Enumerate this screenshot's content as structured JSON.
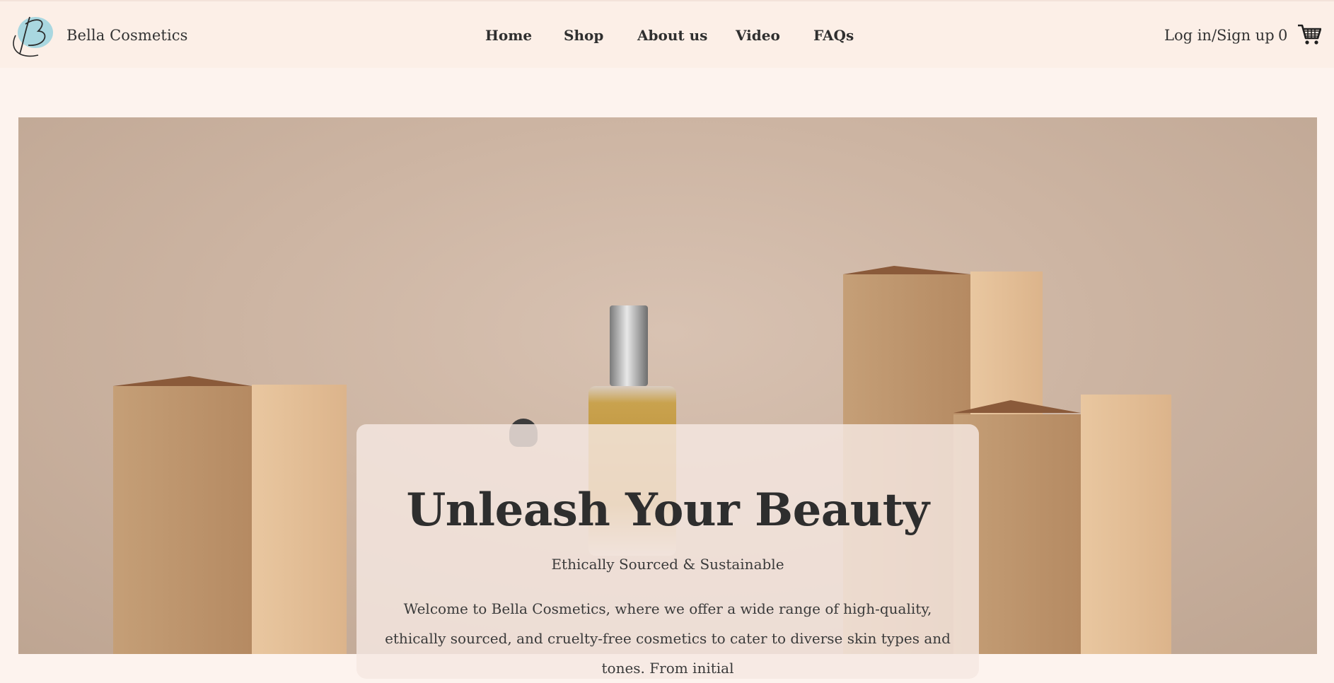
{
  "brand": {
    "name": "Bella Cosmetics",
    "logo_letter": "B"
  },
  "nav": {
    "items": [
      {
        "label": "Home"
      },
      {
        "label": "Shop"
      },
      {
        "label": "About us"
      },
      {
        "label": "Video"
      },
      {
        "label": "FAQs"
      }
    ]
  },
  "account": {
    "login_label": "Log in/Sign up"
  },
  "cart": {
    "count": "0",
    "icon": "cart-icon"
  },
  "hero": {
    "title": "Unleash Your Beauty",
    "subtitle": "Ethically Sourced & Sustainable",
    "body": "Welcome to Bella Cosmetics, where we offer a wide range of high-quality, ethically sourced, and cruelty-free cosmetics to cater to diverse skin types and tones. From initial"
  },
  "colors": {
    "page_bg": "#fdf3ee",
    "header_bg": "#fcefe7",
    "text": "#2f2f2f",
    "logo_accent": "#a9d7e0"
  }
}
